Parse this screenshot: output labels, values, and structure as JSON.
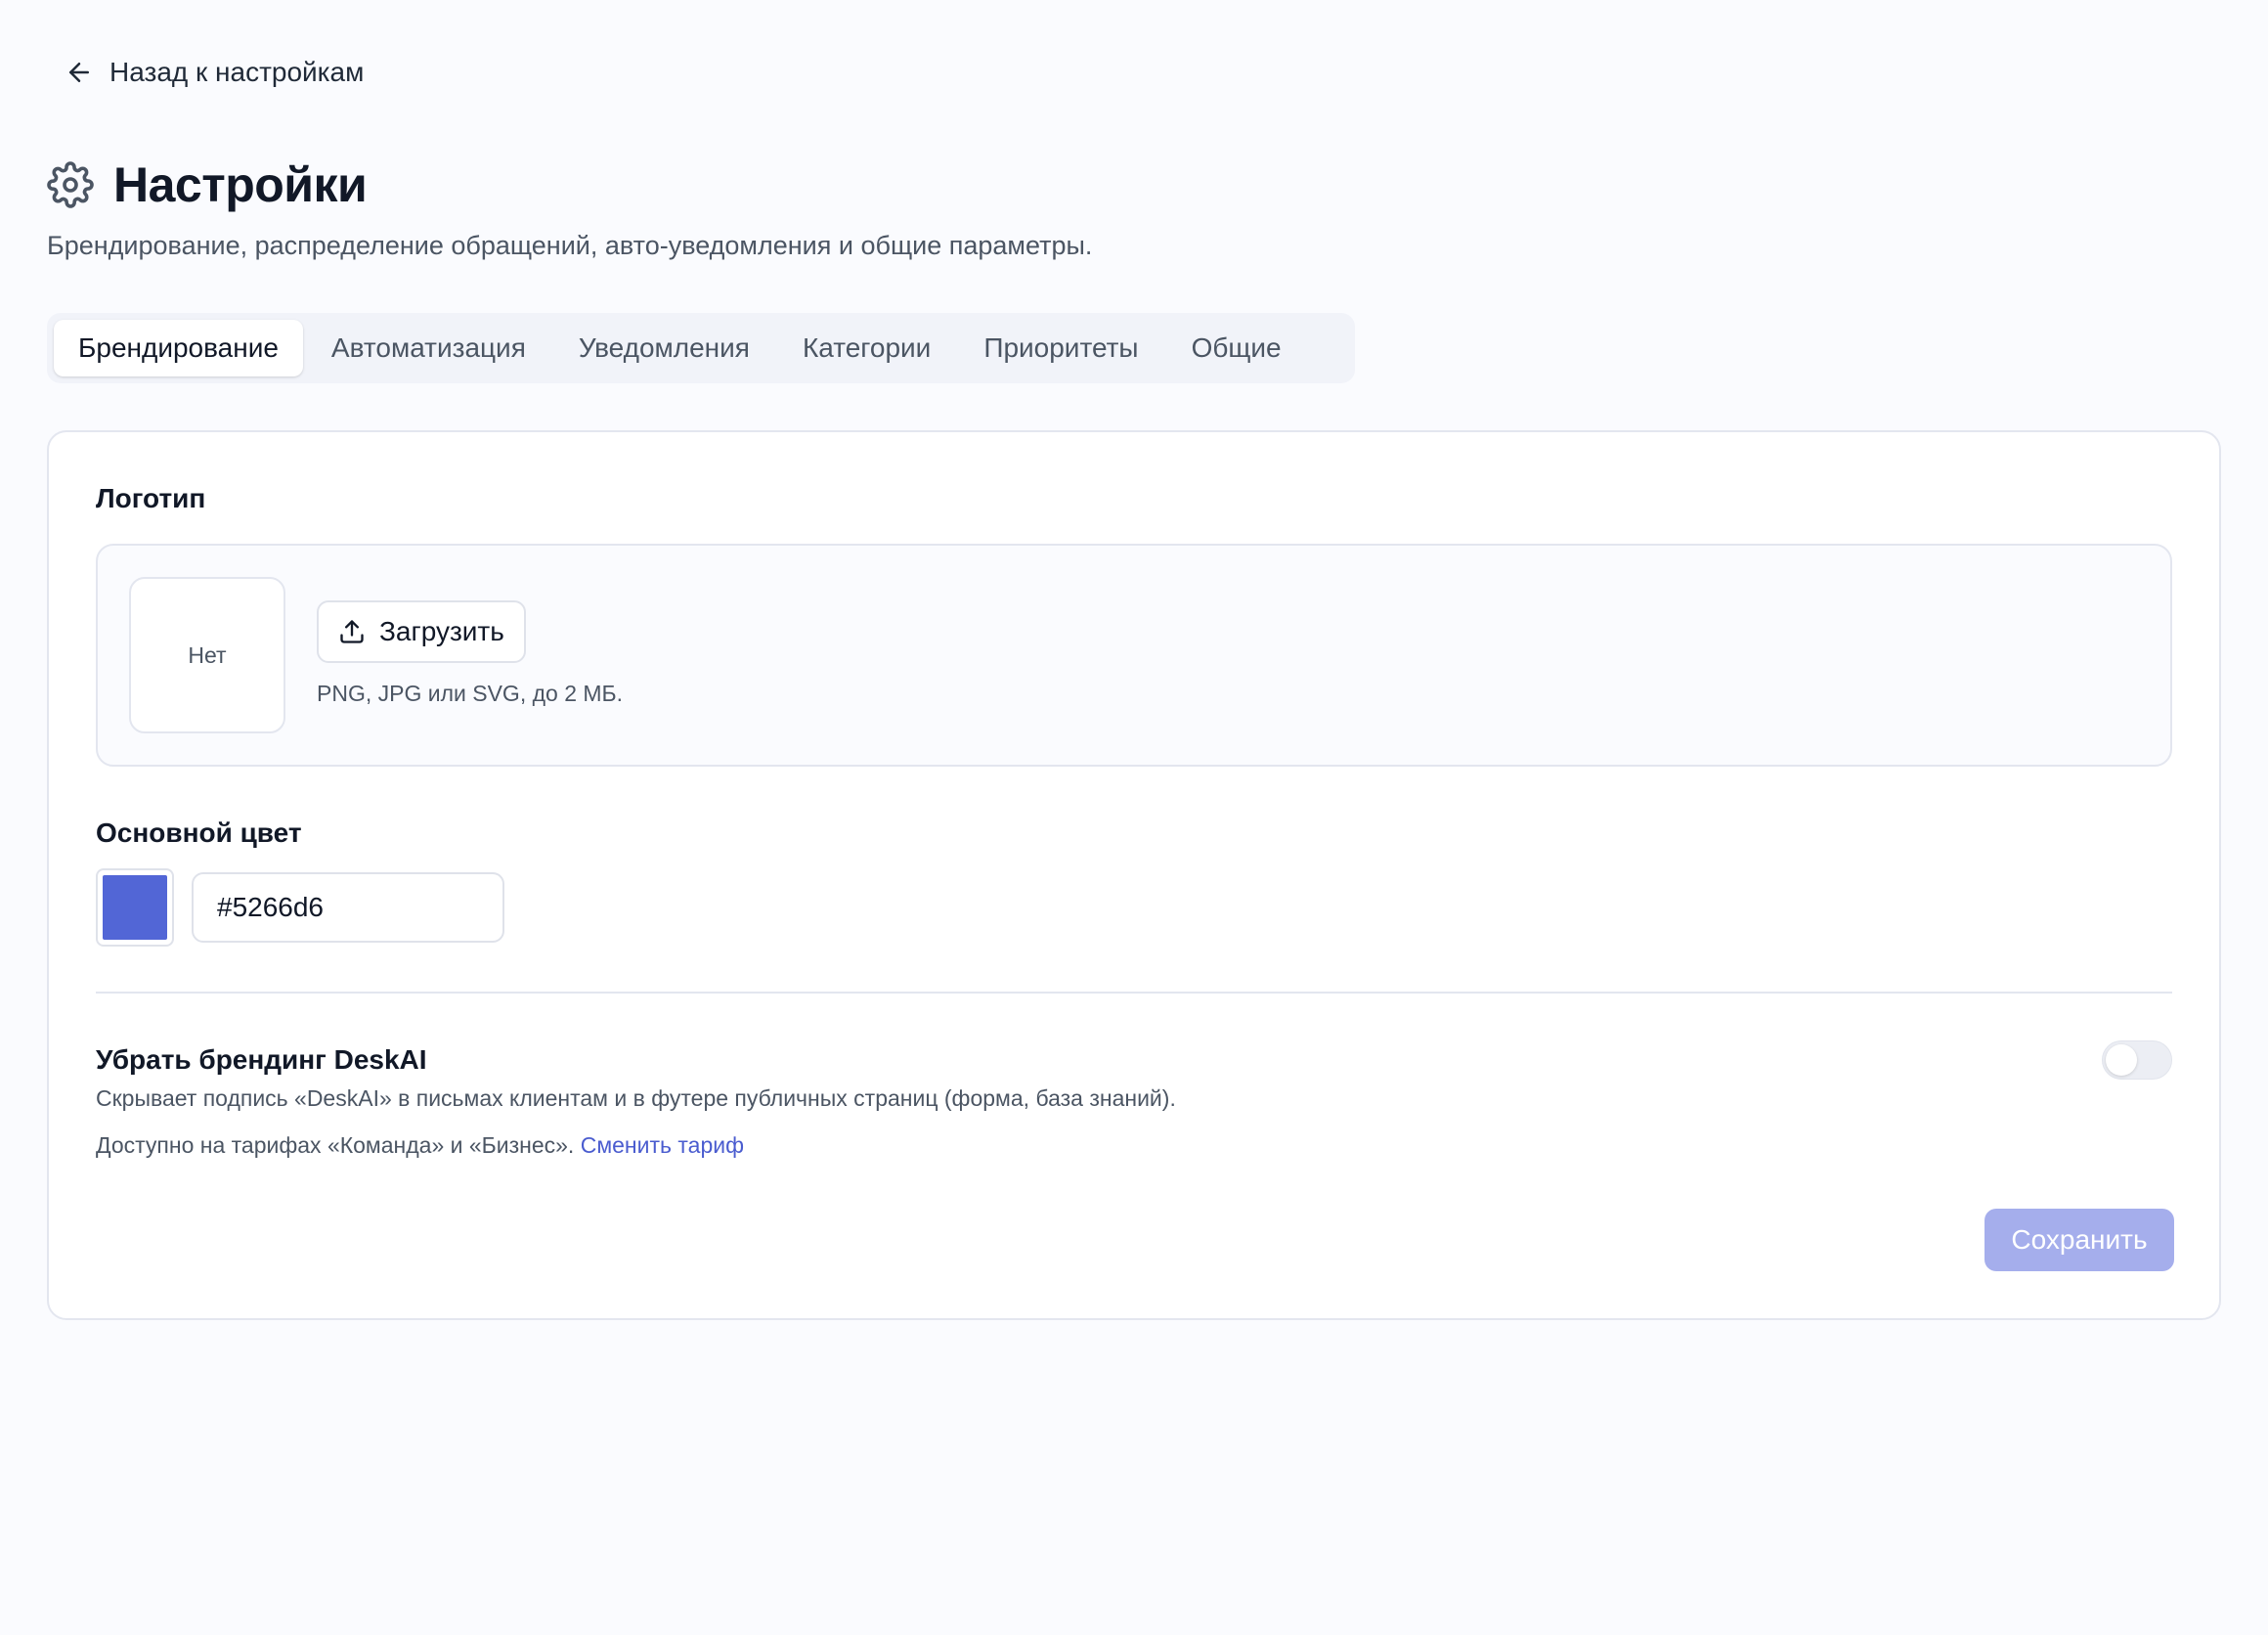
{
  "back_link": {
    "label": "Назад к настройкам",
    "icon": "arrow-left-icon"
  },
  "header": {
    "title": "Настройки",
    "icon": "gear-icon",
    "subtitle": "Брендирование, распределение обращений, авто-уведомления и общие параметры."
  },
  "tabs": [
    {
      "label": "Брендирование",
      "active": true
    },
    {
      "label": "Автоматизация",
      "active": false
    },
    {
      "label": "Уведомления",
      "active": false
    },
    {
      "label": "Категории",
      "active": false
    },
    {
      "label": "Приоритеты",
      "active": false
    },
    {
      "label": "Общие",
      "active": false
    }
  ],
  "logo": {
    "label": "Логотип",
    "preview_text": "Нет",
    "upload_label": "Загрузить",
    "upload_icon": "upload-icon",
    "hint": "PNG, JPG или SVG, до 2 МБ."
  },
  "primary_color": {
    "label": "Основной цвет",
    "value": "#5266d6"
  },
  "remove_branding": {
    "title": "Убрать брендинг DeskAI",
    "description": "Скрывает подпись «DeskAI» в письмах клиентам и в футере публичных страниц (форма, база знаний).",
    "availability": "Доступно на тарифах «Команда» и «Бизнес».",
    "change_plan_link": "Сменить тариф",
    "enabled": false
  },
  "save_button": {
    "label": "Сохранить",
    "disabled": true
  },
  "colors": {
    "accent": "#5266d6",
    "link": "#4a5ccf",
    "save_disabled": "#a5aeec",
    "background": "#fafbfe"
  }
}
